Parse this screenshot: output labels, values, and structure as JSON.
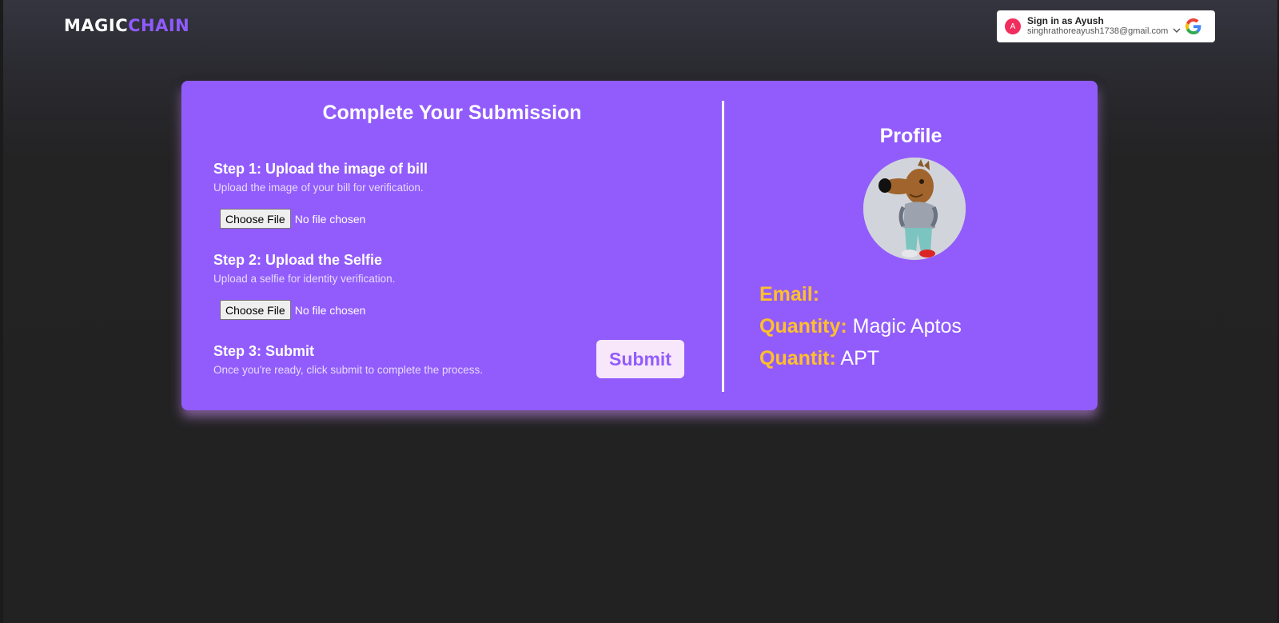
{
  "brand": {
    "part1": "MAGIC",
    "part2": "CHAIN"
  },
  "google_signin": {
    "avatar_letter": "A",
    "title": "Sign in as Ayush",
    "email": "singhrathoreayush1738@gmail.com"
  },
  "submission": {
    "title": "Complete Your Submission",
    "steps": [
      {
        "title": "Step 1: Upload the image of bill",
        "desc": "Upload the image of your bill for verification.",
        "button": "Choose File",
        "status": "No file chosen"
      },
      {
        "title": "Step 2: Upload the Selfie",
        "desc": "Upload a selfie for identity verification.",
        "button": "Choose File",
        "status": "No file chosen"
      },
      {
        "title": "Step 3: Submit",
        "desc": "Once you're ready, click submit to complete the process."
      }
    ],
    "submit_label": "Submit"
  },
  "profile": {
    "title": "Profile",
    "email_label": "Email:",
    "email_value": "",
    "quantity_label": "Quantity:",
    "quantity_value": "Magic Aptos",
    "quantit_label": "Quantit:",
    "quantit_value": "APT"
  },
  "colors": {
    "card": "#925cfc",
    "accent": "#ffc02a",
    "button_bg": "#f8e7fb"
  }
}
